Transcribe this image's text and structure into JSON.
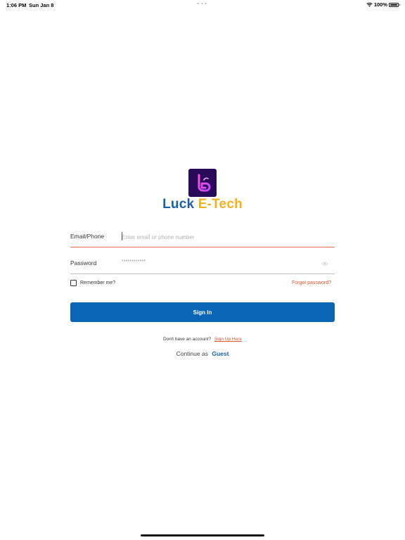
{
  "status_bar": {
    "time": "1:06 PM",
    "date": "Sun Jan 8",
    "battery": "100%"
  },
  "brand": {
    "name_part1": "Luck",
    "name_part2": "E-Tech",
    "logo_color": "#2a0b5a",
    "color_primary": "#1b5ea8",
    "color_secondary": "#f2b21b"
  },
  "form": {
    "email_label": "Email/Phone",
    "email_placeholder": "Enter email or phone number",
    "password_label": "Password",
    "password_mask": "••••••••••••",
    "remember_label": "Remember me?",
    "forgot_label": "Forgot password?",
    "signin_label": "Sign In"
  },
  "footer": {
    "no_account_text": "Don't have an account?",
    "signup_label": "Sign Up Here",
    "continue_text": "Continue as",
    "guest_label": "Guest"
  },
  "colors": {
    "accent_button": "#0b66b7",
    "link_orange": "#e0572e",
    "link_blue": "#1b5ea8"
  }
}
